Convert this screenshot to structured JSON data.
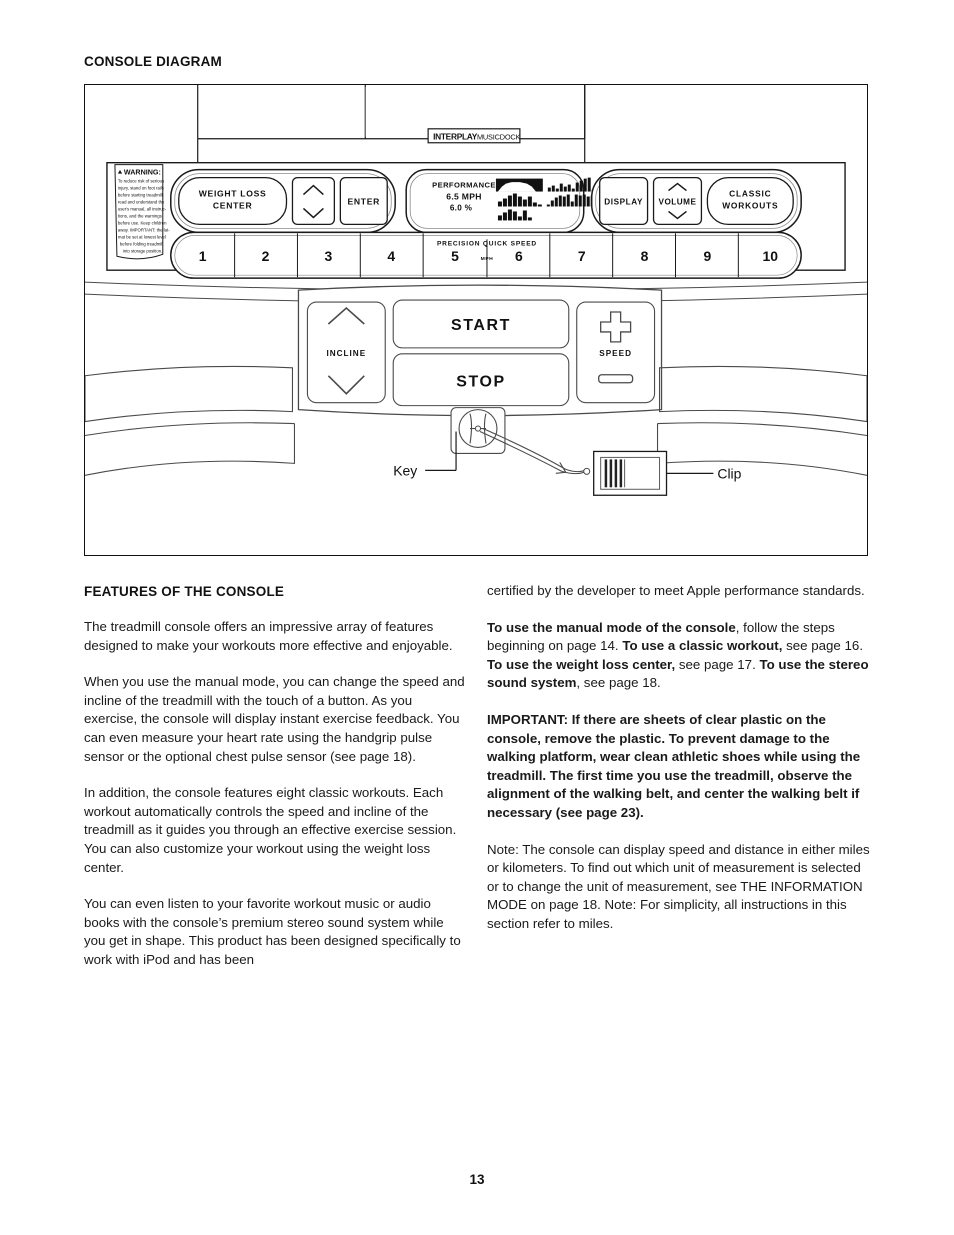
{
  "page": {
    "number": "13"
  },
  "sections": {
    "console_diagram_heading": "CONSOLE DIAGRAM",
    "features_heading": "FEATURES OF THE CONSOLE"
  },
  "diagram": {
    "badge": {
      "brand": "INTERPLAY",
      "product": "MUSICDOCK"
    },
    "warning": {
      "title": "WARNING:",
      "lines": [
        "To reduce risk of serious",
        "injury, stand on foot rails",
        "before starting treadmill;",
        "read and understand the",
        "user's manual, all instruc-",
        "tions, and the warnings",
        "before use. Keep children",
        "away. IMPORTANT: the lat-",
        "mat be set at lowest level",
        "before folding treadmill",
        "into storage position."
      ]
    },
    "buttons": {
      "weight_loss_center": "WEIGHT LOSS\nCENTER",
      "weight_loss_center_line1": "WEIGHT LOSS",
      "weight_loss_center_line2": "CENTER",
      "enter": "ENTER",
      "display": "DISPLAY",
      "volume": "VOLUME",
      "classic_workouts_line1": "CLASSIC",
      "classic_workouts_line2": "WORKOUTS",
      "start": "START",
      "stop": "STOP",
      "incline": "INCLINE",
      "speed": "SPEED"
    },
    "screen": {
      "title": "PERFORMANCE",
      "speed_value": "6.5 MPH",
      "incline_value": "6.0 %"
    },
    "quick_speed": {
      "label": "PRECISION QUICK SPEED",
      "unit": "MPH",
      "numbers": [
        "1",
        "2",
        "3",
        "4",
        "5",
        "6",
        "7",
        "8",
        "9",
        "10"
      ]
    },
    "callouts": {
      "key": "Key",
      "clip": "Clip"
    }
  },
  "body": {
    "left_column": [
      {
        "runs": [
          {
            "text": "The treadmill console offers an impressive array of features designed to make your workouts more effective and enjoyable.",
            "bold": false
          }
        ]
      },
      {
        "runs": [
          {
            "text": "When you use the manual mode, you can change the speed and incline of the treadmill with the touch of a button. As you exercise, the console will display instant exercise feedback. You can even measure your heart rate using the handgrip pulse sensor or the optional chest pulse sensor (see page 18).",
            "bold": false
          }
        ]
      },
      {
        "runs": [
          {
            "text": "In addition, the console features eight classic workouts. Each workout automatically controls the speed and incline of the treadmill as it guides you through an effective exercise session. You can also customize your workout using the weight loss center.",
            "bold": false
          }
        ]
      },
      {
        "runs": [
          {
            "text": "You can even listen to your favorite workout music or audio books with the console’s premium stereo sound system while you get in shape. This product has been designed specifically to work with iPod and has been",
            "bold": false
          }
        ]
      }
    ],
    "right_column": [
      {
        "runs": [
          {
            "text": "certified by the developer to meet Apple performance standards.",
            "bold": false
          }
        ]
      },
      {
        "runs": [
          {
            "text": "To use the manual mode of the console",
            "bold": true
          },
          {
            "text": ", follow the steps beginning on page 14. ",
            "bold": false
          },
          {
            "text": "To use a classic workout,",
            "bold": true
          },
          {
            "text": " see page 16. ",
            "bold": false
          },
          {
            "text": "To use the weight loss center,",
            "bold": true
          },
          {
            "text": " see page 17. ",
            "bold": false
          },
          {
            "text": "To use the stereo sound system",
            "bold": true
          },
          {
            "text": ", see page 18.",
            "bold": false
          }
        ]
      },
      {
        "runs": [
          {
            "text": "IMPORTANT: If there are sheets of clear plastic on the console, remove the plastic. To prevent damage to the walking platform, wear clean athletic shoes while using the treadmill. The first time you use the treadmill, observe the alignment of the walking belt, and center the walking belt if necessary (see page 23).",
            "bold": true
          }
        ]
      },
      {
        "runs": [
          {
            "text": "Note: The console can display speed and distance in either miles or kilometers. To find out which unit of measurement is selected or to change the unit of measurement, see THE INFORMATION MODE on page 18. Note: For simplicity, all instructions in this section refer to miles.",
            "bold": false
          }
        ]
      }
    ]
  }
}
